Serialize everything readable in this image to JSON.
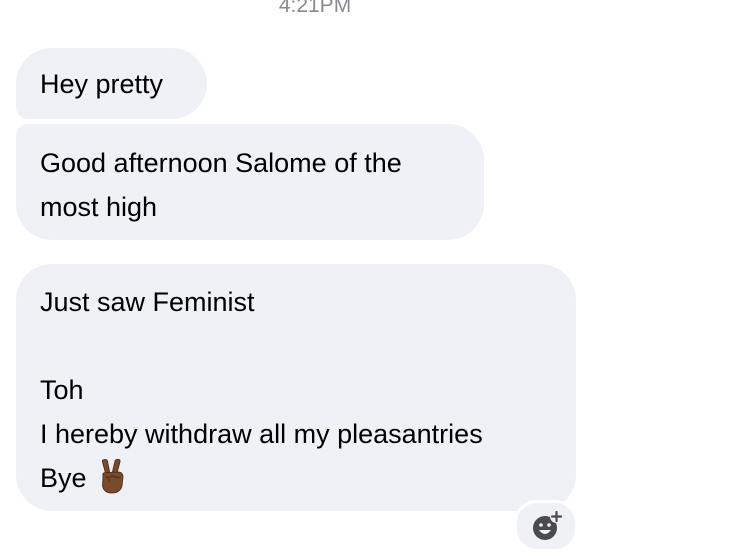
{
  "conversation": {
    "timestamp": "4:21PM",
    "messages": [
      {
        "lines": [
          "Hey pretty"
        ]
      },
      {
        "lines": [
          "Good afternoon Salome of the",
          "most high"
        ]
      },
      {
        "lines": [
          "Just saw Feminist",
          "",
          "Toh",
          "I hereby withdraw all my pleasantries",
          "Bye"
        ],
        "trailing_emoji": "victory-hand-dark-skin-tone"
      }
    ],
    "colors": {
      "incoming_bubble": "#f0f1f6",
      "timestamp_text": "#8a8a8e",
      "emoji_skin": "#7a4a2c"
    },
    "react_icon": "add-reaction-smiley-icon"
  }
}
